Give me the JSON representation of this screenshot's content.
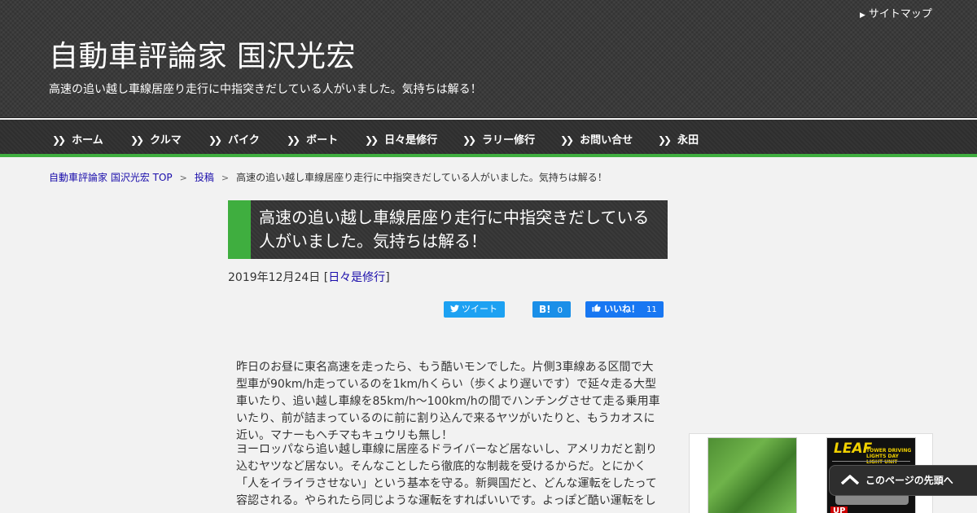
{
  "header": {
    "sitemap_label": "サイトマップ",
    "site_title": "自動車評論家 国沢光宏",
    "site_description": "高速の追い越し車線居座り走行に中指突きだしている人がいました。気持ちは解る！"
  },
  "nav": {
    "items": [
      {
        "label": "ホーム"
      },
      {
        "label": "クルマ"
      },
      {
        "label": "バイク"
      },
      {
        "label": "ボート"
      },
      {
        "label": "日々是修行"
      },
      {
        "label": "ラリー修行"
      },
      {
        "label": "お問い合せ"
      },
      {
        "label": "永田"
      }
    ]
  },
  "breadcrumb": {
    "home": "自動車評論家 国沢光宏 TOP",
    "category": "投稿",
    "current": "高速の追い越し車線居座り走行に中指突きだしている人がいました。気持ちは解る！"
  },
  "post": {
    "title": "高速の追い越し車線居座り走行に中指突きだしている人がいました。気持ちは解る！",
    "date": "2019年12月24日",
    "category_open": "[",
    "category": "日々是修行",
    "category_close": "]",
    "paragraphs": [
      "昨日のお昼に東名高速を走ったら、もう酷いモンでした。片側3車線ある区間で大型車が90km/h走っているのを1km/hくらい（歩くより遅いです）で延々走る大型車いたり、追い越し車線を85km/h～100km/hの間でハンチングさせて走る乗用車いたり、前が詰まっているのに前に割り込んで来るヤツがいたりと、もうカオスに近い。マナーもヘチマもキュウリも無し！",
      "ヨーロッパなら追い越し車線に居座るドライバーなど居ないし、アメリカだと割り込むヤツなど居ない。そんなことしたら徹底的な制裁を受けるからだ。とにかく「人をイライラさせない」という基本を守る。新興国だと、どんな運転をしたって容認される。やられたら同じような運転をすればいいです。よっぽど酷い運転をし"
    ]
  },
  "share": {
    "tweet_label": "ツイート",
    "hatena_label": "B!",
    "hatena_count": "0",
    "like_label": "いいね！",
    "like_count": "11"
  },
  "sidebar": {
    "ad2_brand": "LEAF",
    "ad2_subtitle": "TOWER DRIVING LIGHTS DAY LIGHT UNIT",
    "ad2_badge": "UP"
  },
  "back_to_top": {
    "label": "このページの先頭へ"
  }
}
